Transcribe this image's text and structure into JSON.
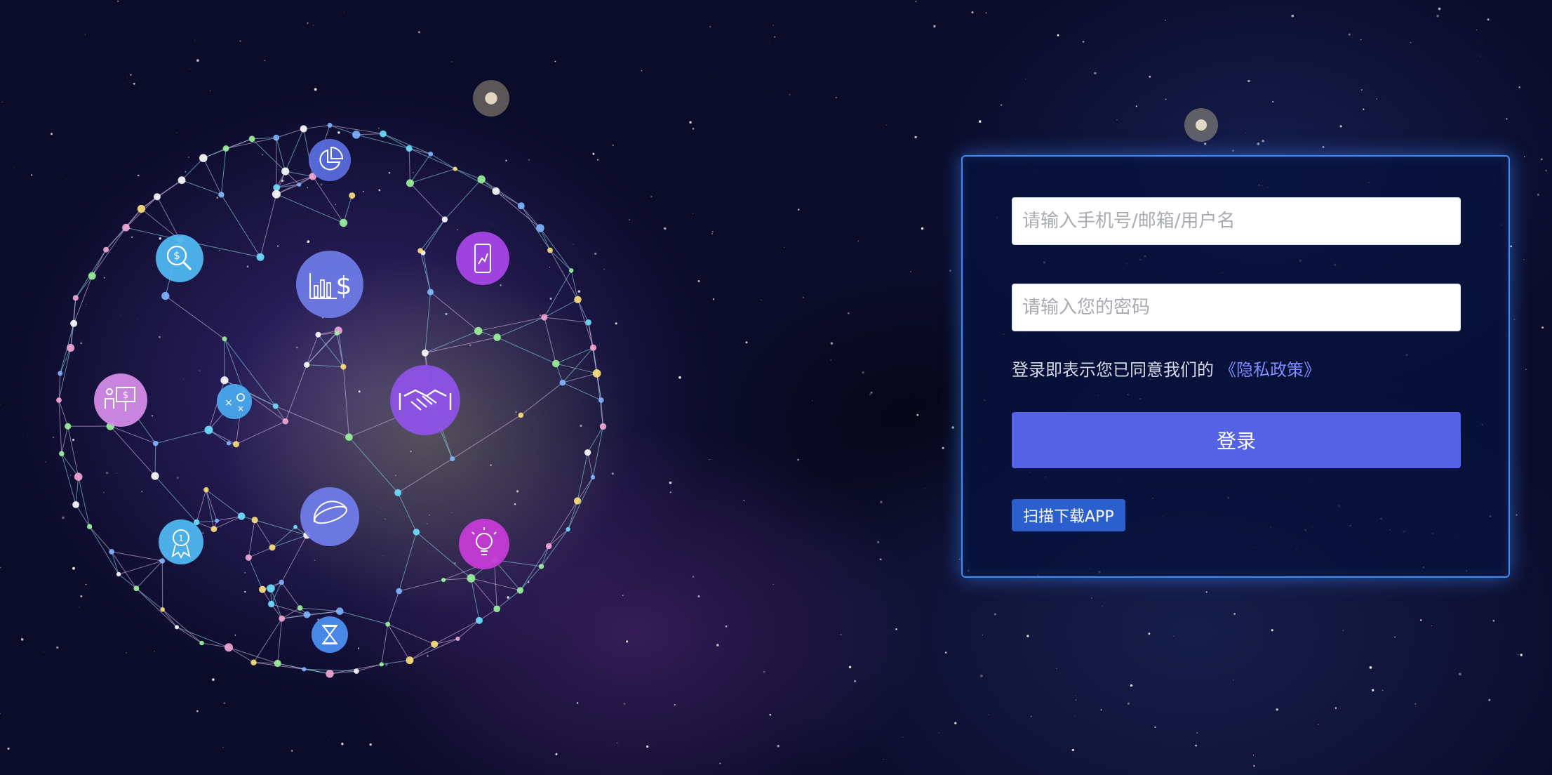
{
  "login": {
    "account_placeholder": "请输入手机号/邮箱/用户名",
    "password_placeholder": "请输入您的密码",
    "agreement_text": "登录即表示您已同意我们的",
    "policy_link": "《隐私政策》",
    "login_button": "登录",
    "download_button": "扫描下载APP"
  },
  "illustration": {
    "icons": [
      "pie-chart-icon",
      "dollar-search-icon",
      "bar-chart-dollar-icon",
      "mobile-chart-icon",
      "presentation-icon",
      "strategy-icon",
      "handshake-icon",
      "rocket-icon",
      "award-medal-icon",
      "lightbulb-icon",
      "hourglass-icon"
    ]
  },
  "colors": {
    "panel_border": "#3e8ef7",
    "login_button": "#5463e6",
    "download_button": "#2b5fce",
    "policy_link": "#7f8cff"
  }
}
